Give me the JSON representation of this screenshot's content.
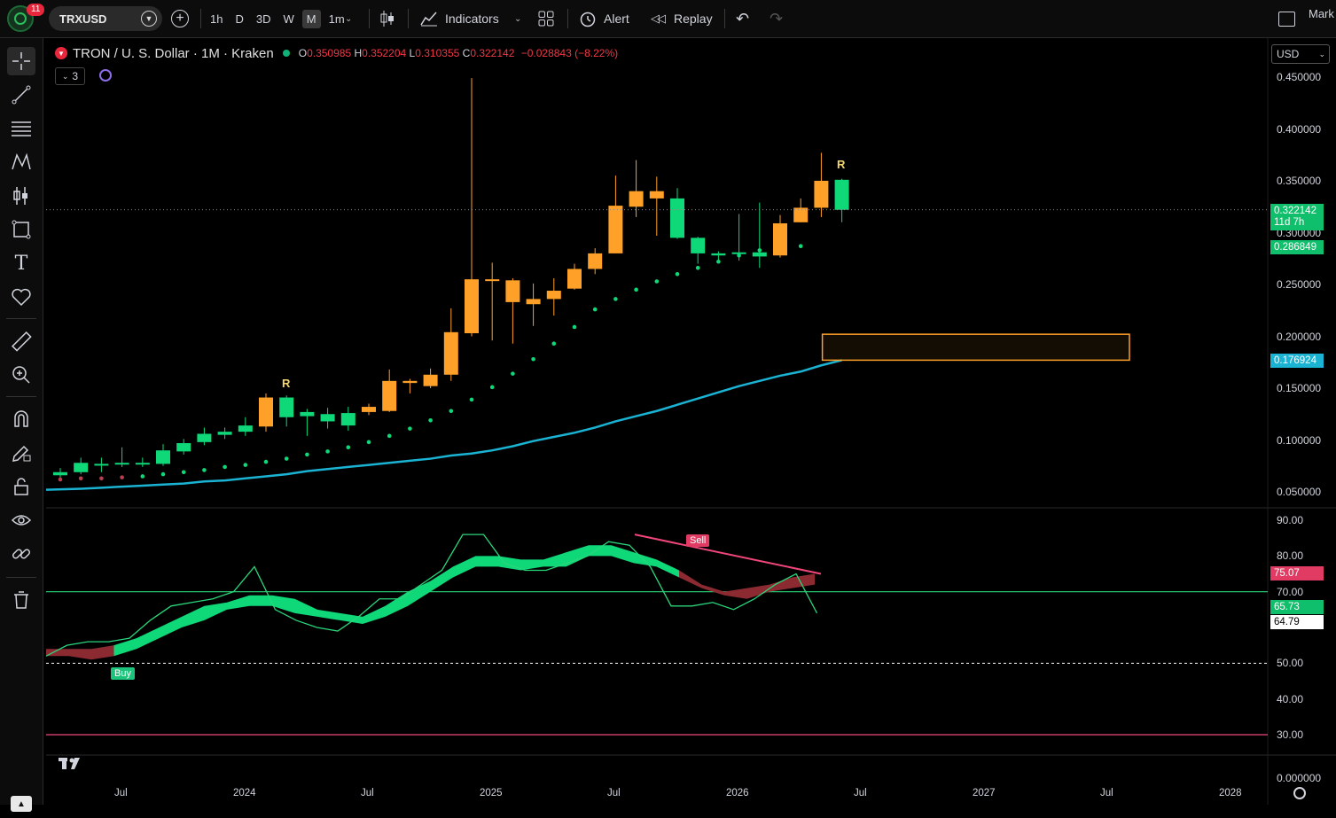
{
  "toolbar": {
    "notification_count": "11",
    "symbol": "TRXUSD",
    "intervals": [
      "1h",
      "D",
      "3D",
      "W",
      "M",
      "1m"
    ],
    "active_interval": "M",
    "indicators_label": "Indicators",
    "alert_label": "Alert",
    "replay_label": "Replay",
    "right_label": "Mark"
  },
  "legend": {
    "title": "TRON / U. S. Dollar · 1M · Kraken",
    "open_key": "O",
    "open": "0.350985",
    "high_key": "H",
    "high": "0.352204",
    "low_key": "L",
    "low": "0.310355",
    "close_key": "C",
    "close": "0.322142",
    "change": "−0.028843 (−8.22%)",
    "indicator_count": "3"
  },
  "currency": "USD",
  "price_axis": [
    "0.450000",
    "0.400000",
    "0.350000",
    "0.300000",
    "0.250000",
    "0.200000",
    "0.150000",
    "0.100000",
    "0.050000"
  ],
  "price_tags": {
    "last": "0.322142",
    "countdown": "11d 7h",
    "sar": "0.286849",
    "ma": "0.176924"
  },
  "osc_axis": [
    "90.00",
    "80.00",
    "70.00",
    "50.00",
    "40.00",
    "30.00"
  ],
  "osc_axis_bottom": "0.000000",
  "osc_tags": {
    "a": "75.07",
    "b": "65.73",
    "c": "64.79"
  },
  "time_axis": [
    "Jul",
    "2024",
    "Jul",
    "2025",
    "Jul",
    "2026",
    "Jul",
    "2027",
    "Jul",
    "2028"
  ],
  "markers": {
    "r": "R",
    "buy": "Buy",
    "sell": "Sell"
  },
  "colors": {
    "up": "#0fd879",
    "down": "#ffa028",
    "ma": "#1ab3d3",
    "rsi_line": "#2ad67a",
    "divergence": "#f0467a",
    "level70": "#2ad67a",
    "level30": "#f0467a"
  },
  "chart_data": {
    "type": "candlestick",
    "interval": "1M",
    "candles": [
      {
        "t": "2023-06",
        "o": 0.066,
        "h": 0.073,
        "l": 0.064,
        "c": 0.069,
        "d": "up"
      },
      {
        "t": "2023-07",
        "o": 0.069,
        "h": 0.083,
        "l": 0.067,
        "c": 0.078,
        "d": "up"
      },
      {
        "t": "2023-08",
        "o": 0.077,
        "h": 0.083,
        "l": 0.069,
        "c": 0.076,
        "d": "up"
      },
      {
        "t": "2023-09",
        "o": 0.077,
        "h": 0.093,
        "l": 0.074,
        "c": 0.078,
        "d": "up"
      },
      {
        "t": "2023-10",
        "o": 0.077,
        "h": 0.083,
        "l": 0.074,
        "c": 0.078,
        "d": "up"
      },
      {
        "t": "2023-11",
        "o": 0.077,
        "h": 0.096,
        "l": 0.075,
        "c": 0.09,
        "d": "up"
      },
      {
        "t": "2023-12",
        "o": 0.089,
        "h": 0.101,
        "l": 0.086,
        "c": 0.097,
        "d": "up"
      },
      {
        "t": "2024-01",
        "o": 0.098,
        "h": 0.112,
        "l": 0.095,
        "c": 0.106,
        "d": "up"
      },
      {
        "t": "2024-02",
        "o": 0.105,
        "h": 0.112,
        "l": 0.101,
        "c": 0.108,
        "d": "up"
      },
      {
        "t": "2024-03",
        "o": 0.108,
        "h": 0.122,
        "l": 0.104,
        "c": 0.114,
        "d": "up"
      },
      {
        "t": "2024-04",
        "o": 0.113,
        "h": 0.145,
        "l": 0.108,
        "c": 0.141,
        "d": "down"
      },
      {
        "t": "2024-05",
        "o": 0.122,
        "h": 0.143,
        "l": 0.113,
        "c": 0.141,
        "d": "up"
      },
      {
        "t": "2024-06",
        "o": 0.127,
        "h": 0.13,
        "l": 0.104,
        "c": 0.123,
        "d": "up"
      },
      {
        "t": "2024-07",
        "o": 0.118,
        "h": 0.131,
        "l": 0.111,
        "c": 0.125,
        "d": "up"
      },
      {
        "t": "2024-08",
        "o": 0.114,
        "h": 0.132,
        "l": 0.109,
        "c": 0.126,
        "d": "up"
      },
      {
        "t": "2024-09",
        "o": 0.127,
        "h": 0.135,
        "l": 0.124,
        "c": 0.132,
        "d": "down"
      },
      {
        "t": "2024-10",
        "o": 0.157,
        "h": 0.168,
        "l": 0.127,
        "c": 0.128,
        "d": "down"
      },
      {
        "t": "2024-11",
        "o": 0.157,
        "h": 0.159,
        "l": 0.145,
        "c": 0.155,
        "d": "down"
      },
      {
        "t": "2024-12",
        "o": 0.163,
        "h": 0.169,
        "l": 0.15,
        "c": 0.152,
        "d": "down"
      },
      {
        "t": "2025-01",
        "o": 0.204,
        "h": 0.227,
        "l": 0.157,
        "c": 0.163,
        "d": "down"
      },
      {
        "t": "2025-02",
        "o": 0.255,
        "h": 0.449,
        "l": 0.2,
        "c": 0.203,
        "d": "down"
      },
      {
        "t": "2025-03",
        "o": 0.254,
        "h": 0.271,
        "l": 0.196,
        "c": 0.255,
        "d": "down"
      },
      {
        "t": "2025-04",
        "o": 0.254,
        "h": 0.256,
        "l": 0.193,
        "c": 0.233,
        "d": "down"
      },
      {
        "t": "2025-05",
        "o": 0.236,
        "h": 0.251,
        "l": 0.21,
        "c": 0.231,
        "d": "down"
      },
      {
        "t": "2025-06",
        "o": 0.244,
        "h": 0.256,
        "l": 0.22,
        "c": 0.236,
        "d": "down"
      },
      {
        "t": "2025-07",
        "o": 0.265,
        "h": 0.27,
        "l": 0.245,
        "c": 0.246,
        "d": "down"
      },
      {
        "t": "2025-08",
        "o": 0.28,
        "h": 0.285,
        "l": 0.26,
        "c": 0.265,
        "d": "down"
      },
      {
        "t": "2025-09",
        "o": 0.326,
        "h": 0.355,
        "l": 0.28,
        "c": 0.28,
        "d": "down"
      },
      {
        "t": "2025-10",
        "o": 0.34,
        "h": 0.37,
        "l": 0.315,
        "c": 0.325,
        "d": "down"
      },
      {
        "t": "2025-11",
        "o": 0.34,
        "h": 0.354,
        "l": 0.297,
        "c": 0.333,
        "d": "down"
      },
      {
        "t": "2025-12",
        "o": 0.333,
        "h": 0.343,
        "l": 0.294,
        "c": 0.295,
        "d": "up"
      },
      {
        "t": "2026-01",
        "o": 0.295,
        "h": 0.296,
        "l": 0.27,
        "c": 0.28,
        "d": "up"
      },
      {
        "t": "2026-02",
        "o": 0.28,
        "h": 0.282,
        "l": 0.272,
        "c": 0.278,
        "d": "up"
      },
      {
        "t": "2026-03",
        "o": 0.28,
        "h": 0.318,
        "l": 0.273,
        "c": 0.281,
        "d": "up"
      },
      {
        "t": "2026-04",
        "o": 0.281,
        "h": 0.329,
        "l": 0.266,
        "c": 0.277,
        "d": "up"
      },
      {
        "t": "2026-05",
        "o": 0.309,
        "h": 0.317,
        "l": 0.276,
        "c": 0.278,
        "d": "down"
      },
      {
        "t": "2026-06",
        "o": 0.324,
        "h": 0.333,
        "l": 0.31,
        "c": 0.31,
        "d": "down"
      },
      {
        "t": "2026-07",
        "o": 0.35,
        "h": 0.377,
        "l": 0.315,
        "c": 0.324,
        "d": "down"
      },
      {
        "t": "2026-08",
        "o": 0.351,
        "h": 0.352,
        "l": 0.31,
        "c": 0.322,
        "d": "up"
      }
    ],
    "sar": [
      0.062,
      0.063,
      0.063,
      0.064,
      0.065,
      0.067,
      0.069,
      0.071,
      0.074,
      0.076,
      0.079,
      0.082,
      0.086,
      0.089,
      0.093,
      0.098,
      0.104,
      0.111,
      0.119,
      0.128,
      0.139,
      0.151,
      0.164,
      0.178,
      0.193,
      0.209,
      0.226,
      0.236,
      0.245,
      0.253,
      0.26,
      0.266,
      0.272,
      0.278,
      0.283,
      0.286,
      0.287
    ],
    "ma": [
      0.052,
      0.053,
      0.054,
      0.055,
      0.056,
      0.057,
      0.058,
      0.06,
      0.061,
      0.063,
      0.065,
      0.067,
      0.07,
      0.072,
      0.074,
      0.076,
      0.078,
      0.08,
      0.082,
      0.085,
      0.087,
      0.09,
      0.094,
      0.099,
      0.103,
      0.107,
      0.112,
      0.118,
      0.123,
      0.128,
      0.134,
      0.14,
      0.146,
      0.152,
      0.157,
      0.162,
      0.166,
      0.172,
      0.177
    ],
    "zone": {
      "from": "2026-08",
      "to": "2027-09",
      "top": 0.202,
      "bottom": 0.177
    },
    "oscillator": {
      "line": [
        52,
        55,
        56,
        56,
        57,
        62,
        66,
        67,
        68,
        70,
        77,
        65,
        62,
        60,
        59,
        63,
        68,
        68,
        72,
        76,
        86,
        86,
        78,
        76,
        76,
        78,
        80,
        84,
        83,
        77,
        66,
        66,
        67,
        65,
        68,
        72,
        75,
        64
      ],
      "band_upper": [
        54,
        54,
        54,
        55,
        57,
        60,
        63,
        66,
        67,
        69,
        69,
        68,
        65,
        64,
        63,
        66,
        70,
        73,
        77,
        80,
        80,
        79,
        79,
        81,
        83,
        83,
        81,
        79,
        76,
        72,
        70,
        71,
        72,
        74,
        75
      ],
      "band_lower": [
        52,
        52,
        51,
        52,
        54,
        57,
        60,
        62,
        65,
        66,
        66,
        64,
        63,
        62,
        61,
        63,
        66,
        70,
        74,
        77,
        77,
        76,
        77,
        77,
        80,
        80,
        78,
        77,
        74,
        71,
        69,
        68,
        70,
        71,
        72
      ],
      "levels": [
        90,
        80,
        70,
        50,
        40,
        30
      ],
      "buy_at": "2023-09",
      "sell_at": "2025-12"
    },
    "price_range": [
      0.0,
      0.46
    ]
  }
}
